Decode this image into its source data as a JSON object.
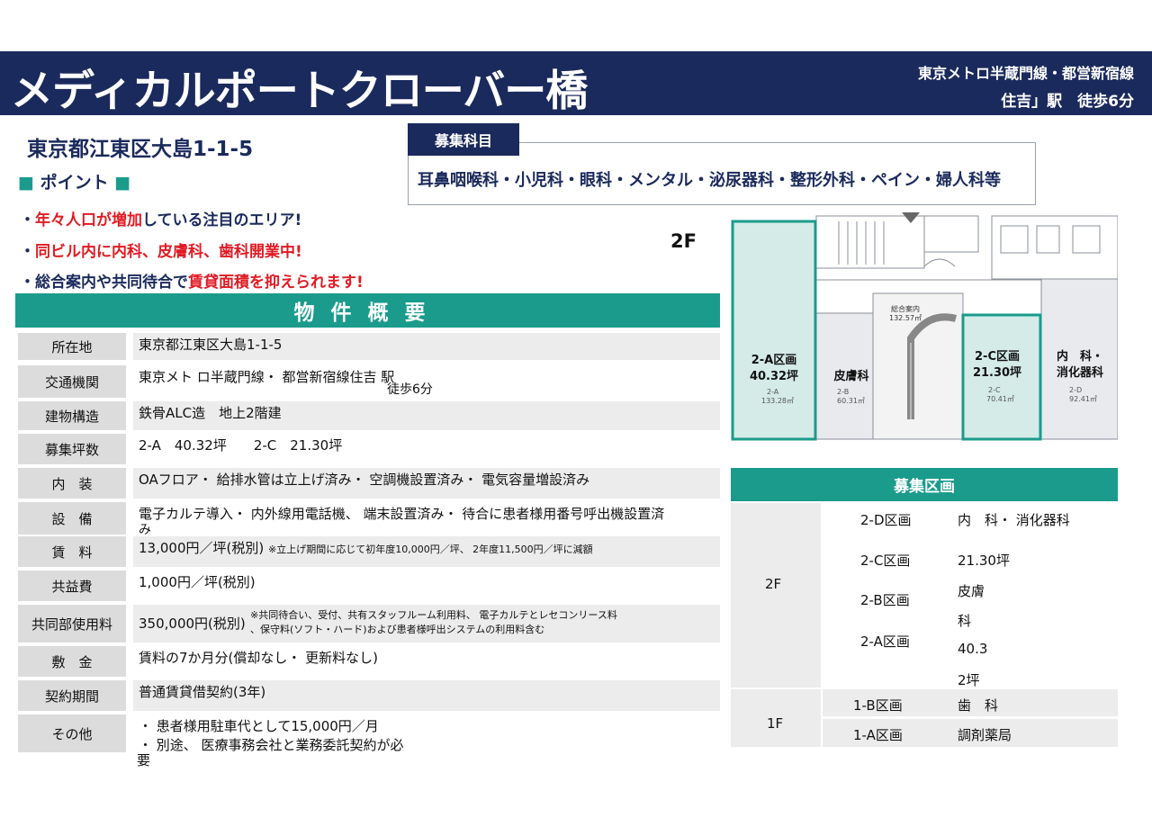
{
  "header": {
    "title": "メディカルポートクローバー橋",
    "station_line": "東京メトロ半蔵門線・都営新宿線",
    "station_walk": "住吉」駅　徒歩6分"
  },
  "address": "東京都江東区大島1-1-5",
  "points": {
    "heading": "ポイント",
    "items": [
      {
        "pre": "・",
        "emph": "年々人口が増加",
        "post": "している注目のエリア!"
      },
      {
        "pre": "・",
        "emph": "同ビル内に内科、皮膚科、歯科開業中!",
        "post": ""
      },
      {
        "pre": "・総合案内や共同待合で",
        "emph": "賃貸面積を抑えられます!",
        "post": ""
      }
    ]
  },
  "subjects": {
    "label": "募集科目",
    "text": "耳鼻咽喉科・小児科・眼科・メンタル・泌尿器科・整形外科・ペイン・婦人科等"
  },
  "overview": {
    "heading": "物件概要",
    "rows": [
      {
        "label": "所在地",
        "value": "東京都江東区大島1-1-5",
        "note": ""
      },
      {
        "label": "交通機関",
        "value": "東京メト ロ半蔵門線・ 都営新宿線住吉 駅",
        "note": "徒歩6分"
      },
      {
        "label": "建物構造",
        "value": "鉄骨ALC造　地上2階建",
        "note": ""
      },
      {
        "label": "募集坪数",
        "value": "2-A　40.32坪　　2-C　21.30坪",
        "note": ""
      },
      {
        "label": "内　装",
        "value": "OAフロア・ 給排水管は立上げ済み・ 空調機設置済み・ 電気容量増設済み",
        "note": ""
      },
      {
        "label": "設　備",
        "value": "電子カルテ導入・ 内外線用電話機、 端末設置済み・ 待合に患者様用番号呼出機設置済",
        "note": "み"
      },
      {
        "label": "賃　料",
        "value": "13,000円／坪(税別)",
        "note": "※立上げ期間に応じて初年度10,000円／坪、 2年度11,500円／坪に減額"
      },
      {
        "label": "共益費",
        "value": "1,000円／坪(税別)",
        "note": ""
      },
      {
        "label": "共同部使用料",
        "value": "350,000円(税別)",
        "note": "※共同待合い、受付、共有スタッフルーム利用料、 電子カルテとレセコンリース料",
        "note2": "、保守料(ソフト・ハード)および患者様呼出システムの利用料含む"
      },
      {
        "label": "敷　金",
        "value": "賃料の7か月分(償却なし・ 更新料なし)",
        "note": ""
      },
      {
        "label": "契約期間",
        "value": "普通賃貸借契約(3年)",
        "note": ""
      },
      {
        "label": "その他",
        "value": "・ 患者様用駐車代として15,000円／月",
        "note": "・ 別途、 医療事務会社と業務委託契約が必",
        "note2": "要"
      }
    ]
  },
  "floor_plan": {
    "floor_label": "2F",
    "units": [
      {
        "id": "2-A",
        "title": "2-A区画",
        "tsubo": "40.32坪",
        "sub_id": "2-A",
        "area": "133.28㎡"
      },
      {
        "id": "2-B",
        "title": "皮膚科",
        "sub_id": "2-B",
        "area": "60.31㎡"
      },
      {
        "id": "2-C",
        "title": "2-C区画",
        "tsubo": "21.30坪",
        "sub_id": "2-C",
        "area": "70.41㎡"
      },
      {
        "id": "2-D",
        "title": "内　科・",
        "title2": "消化器科",
        "sub_id": "2-D",
        "area": "92.41㎡"
      }
    ],
    "center": {
      "label": "総合案内",
      "area": "132.57㎡"
    }
  },
  "recruit_area": {
    "heading": "募集区画",
    "floor2": "2F",
    "f2_units": [
      "2-D区画",
      "2-C区画",
      "2-B区画",
      "2-A区画"
    ],
    "f2_values": [
      "内　科・ 消化器科",
      "21.30坪",
      "皮膚",
      "科",
      "40.3",
      "2坪"
    ],
    "floor1": "1F",
    "f1_rows": [
      {
        "unit": "1-B区画",
        "value": "歯　科"
      },
      {
        "unit": "1-A区画",
        "value": "調剤薬局"
      }
    ]
  }
}
